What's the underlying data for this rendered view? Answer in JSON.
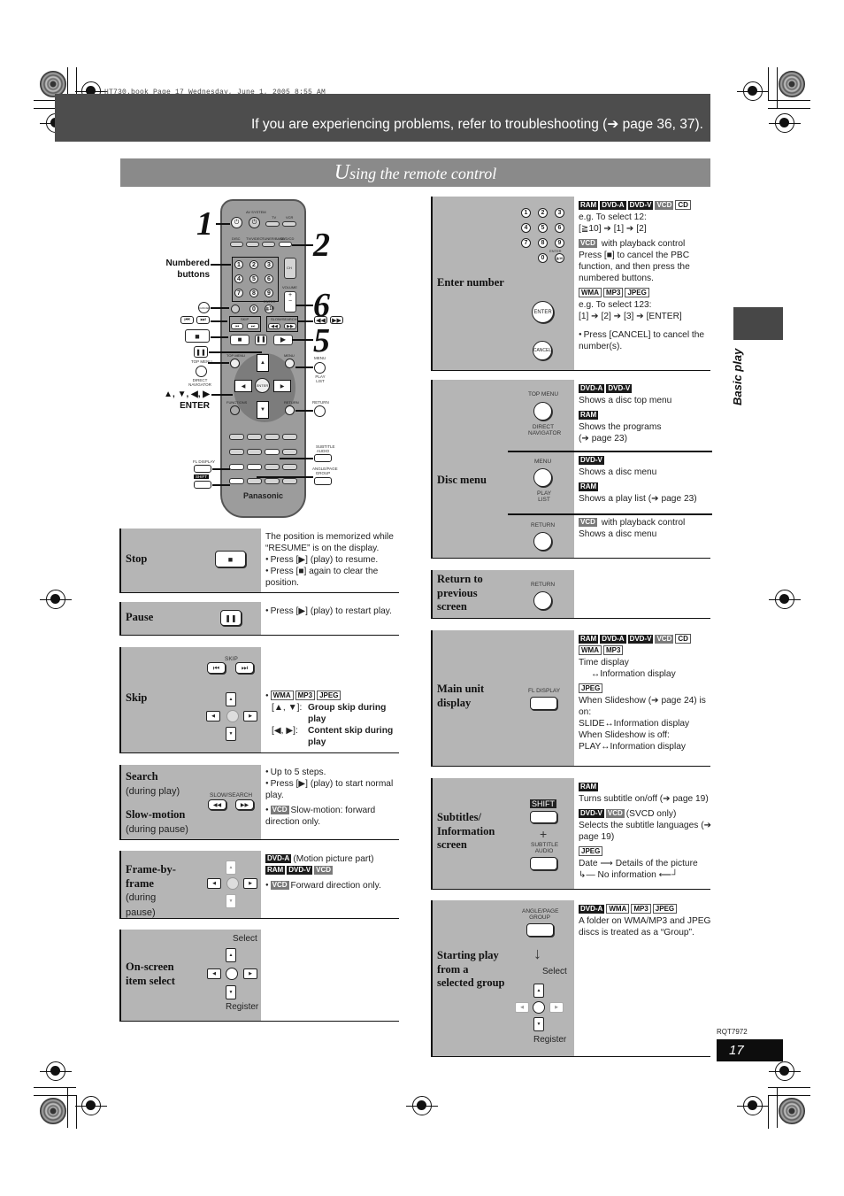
{
  "print_header": "HT730.book  Page 17  Wednesday, June 1, 2005  8:55 AM",
  "banner": {
    "text": "If you are experiencing problems, refer to troubleshooting (➔ page 36, 37)."
  },
  "section_title": {
    "first_letter": "U",
    "rest": "sing the remote control"
  },
  "side_tab": {
    "label": "Basic play"
  },
  "remote": {
    "brand": "Panasonic",
    "labels": {
      "av_system": "AV SYSTEM",
      "tv": "TV",
      "vcr": "VCR",
      "disc": "DISC",
      "tv_video": "TV/VIDEO",
      "tuner_band": "TUNER/BAND",
      "dvd_cd": "DVD/CD",
      "ch": "CH",
      "volume": "VOLUME",
      "enter": "ENTER",
      "cancel": "CANCEL",
      "skip": "SKIP",
      "slow_search": "SLOW/SEARCH",
      "top_menu": "TOP MENU",
      "direct_navigator": "DIRECT NAVIGATOR",
      "menu": "MENU",
      "play_list": "PLAY LIST",
      "functions": "FUNCTIONS",
      "tv_vol_minus": "TV VOL -",
      "return": "RETURN",
      "tv_vol_plus": "TV VOL +",
      "fl_display": "FL DISPLAY",
      "shift": "SHIFT",
      "subtitle_audio": "SUBTITLE AUDIO",
      "angle_page_group": "ANGLE/PAGE GROUP"
    },
    "numbers": [
      "1",
      "2",
      "3",
      "4",
      "5",
      "6",
      "7",
      "8",
      "9",
      "0"
    ],
    "callouts": {
      "step1": "1",
      "step2": "2",
      "step5": "5",
      "step6": "6",
      "numbered_buttons": "Numbered buttons",
      "arrows_enter_glyphs": "▲, ▼, ◀, ▶",
      "arrows_enter_label": "ENTER"
    }
  },
  "left_table": [
    {
      "title": "Stop",
      "button": "■",
      "desc": [
        "The position is memorized while “RESUME” is on the display."
      ],
      "bullets": [
        "Press [▶] (play) to resume.",
        "Press [■] again to clear the position."
      ]
    },
    {
      "title": "Pause",
      "button": "❚❚",
      "bullets": [
        "Press [▶] (play) to restart play."
      ]
    },
    {
      "title": "Skip",
      "button_label": "SKIP",
      "buttons": [
        "⏮",
        "⏭"
      ],
      "tags": [
        "WMA",
        "MP3",
        "JPEG"
      ],
      "items": [
        {
          "keys": "[▲, ▼]:",
          "text": "Group skip during play"
        },
        {
          "keys": "[◀, ▶]:",
          "text": "Content skip during play"
        }
      ]
    },
    {
      "title": "Search",
      "title_sub": "(during play)",
      "title2": "Slow-motion",
      "title2_sub": "(during pause)",
      "button_label": "SLOW/SEARCH",
      "buttons": [
        "◀◀",
        "▶▶"
      ],
      "bullets": [
        "Up to 5 steps.",
        "Press [▶] (play) to start normal play."
      ],
      "vcd_tag": "VCD",
      "vcd_note": "Slow-motion: forward direction only."
    },
    {
      "title": "Frame-by-frame",
      "title_sub": "(during pause)",
      "line1_tag": "DVD-A",
      "line1_text": "(Motion picture part)",
      "line2_tags": [
        "RAM",
        "DVD-V",
        "VCD"
      ],
      "vcd_tag": "VCD",
      "vcd_note": "Forward direction only."
    },
    {
      "title": "On-screen item select",
      "select_label": "Select",
      "register_label": "Register"
    }
  ],
  "right_table": [
    {
      "title": "Enter number",
      "groups": [
        {
          "tags": [
            "RAM",
            "DVD-A",
            "DVD-V",
            "VCD",
            "CD"
          ],
          "lines": [
            "e.g. To select 12:",
            "[≧10] ➔ [1] ➔ [2]"
          ]
        },
        {
          "tags": [
            "VCD"
          ],
          "lead": "with playback control",
          "lines": [
            "Press [■] to cancel the PBC function, and then press the numbered buttons."
          ]
        },
        {
          "tags": [
            "WMA",
            "MP3",
            "JPEG"
          ],
          "lines": [
            "e.g. To select 123:",
            "[1] ➔ [2] ➔ [3] ➔ [ENTER]"
          ]
        }
      ],
      "bullet": "Press [CANCEL] to cancel the number(s).",
      "enter_label": "ENTER",
      "cancel_label": "CANCEL",
      "numpad_enter": "ENTER"
    },
    {
      "title": "Disc menu",
      "subrows": [
        {
          "top_label": "TOP MENU",
          "bottom_label": "DIRECT NAVIGATOR",
          "groups": [
            {
              "tags": [
                "DVD-A",
                "DVD-V"
              ],
              "lines": [
                "Shows a disc top menu"
              ]
            },
            {
              "tags": [
                "RAM"
              ],
              "lines": [
                "Shows the programs",
                "(➔ page 23)"
              ]
            }
          ]
        },
        {
          "top_label": "MENU",
          "bottom_label": "PLAY LIST",
          "groups": [
            {
              "tags": [
                "DVD-V"
              ],
              "lines": [
                "Shows a disc menu"
              ]
            },
            {
              "tags": [
                "RAM"
              ],
              "lines": [
                "Shows a play list (➔ page 23)"
              ]
            }
          ]
        },
        {
          "top_label": "RETURN",
          "bottom_label": "",
          "groups": [
            {
              "tags": [
                "VCD"
              ],
              "lead": "with playback control",
              "lines": [
                "Shows a disc menu"
              ]
            }
          ]
        }
      ]
    },
    {
      "title": "Return to previous screen",
      "button_label": "RETURN"
    },
    {
      "title": "Main unit display",
      "button_label": "FL DISPLAY",
      "groups": [
        {
          "tags": [
            "RAM",
            "DVD-A",
            "DVD-V",
            "VCD",
            "CD",
            "WMA",
            "MP3"
          ],
          "lines": [
            "Time display",
            "↔Information display"
          ]
        },
        {
          "tags": [
            "JPEG"
          ],
          "lines": [
            "When Slideshow (➔ page 24) is on:",
            "SLIDE↔Information display",
            "When Slideshow is off:",
            "PLAY↔Information display"
          ]
        }
      ]
    },
    {
      "title": "Subtitles/ Information screen",
      "shift_label": "SHIFT",
      "plus": "+",
      "button_label": "SUBTITLE AUDIO",
      "groups": [
        {
          "tags": [
            "RAM"
          ],
          "lines": [
            "Turns subtitle on/off (➔ page 19)"
          ]
        },
        {
          "tags": [
            "DVD-V",
            "VCD"
          ],
          "lead": "(SVCD only)",
          "lines": [
            "Selects the subtitle languages (➔ page 19)"
          ]
        },
        {
          "tags": [
            "JPEG"
          ],
          "lines": [
            "Date ⟶ Details of the picture",
            "↳— No information ⟵┘"
          ]
        }
      ]
    },
    {
      "title": "Starting play from a selected group",
      "button_label": "ANGLE/PAGE GROUP",
      "down_arrow": "↓",
      "select_label": "Select",
      "register_label": "Register",
      "tags": [
        "DVD-A",
        "WMA",
        "MP3",
        "JPEG"
      ],
      "lines": [
        "A folder on WMA/MP3 and JPEG discs is treated as a “Group”."
      ]
    }
  ],
  "footer": {
    "doc_code": "RQT7972",
    "page_number": "17"
  },
  "tag_styles": {
    "RAM": "dark",
    "DVD-A": "dark",
    "DVD-V": "dark",
    "VCD": "mid",
    "CD": "out",
    "WMA": "out",
    "MP3": "out",
    "JPEG": "out"
  },
  "colors": {
    "banner_bg": "#4d4d4d",
    "title_bg": "#8a8a8a",
    "cell_gray": "#b5b5b5",
    "page_box": "#0d0d0d"
  }
}
